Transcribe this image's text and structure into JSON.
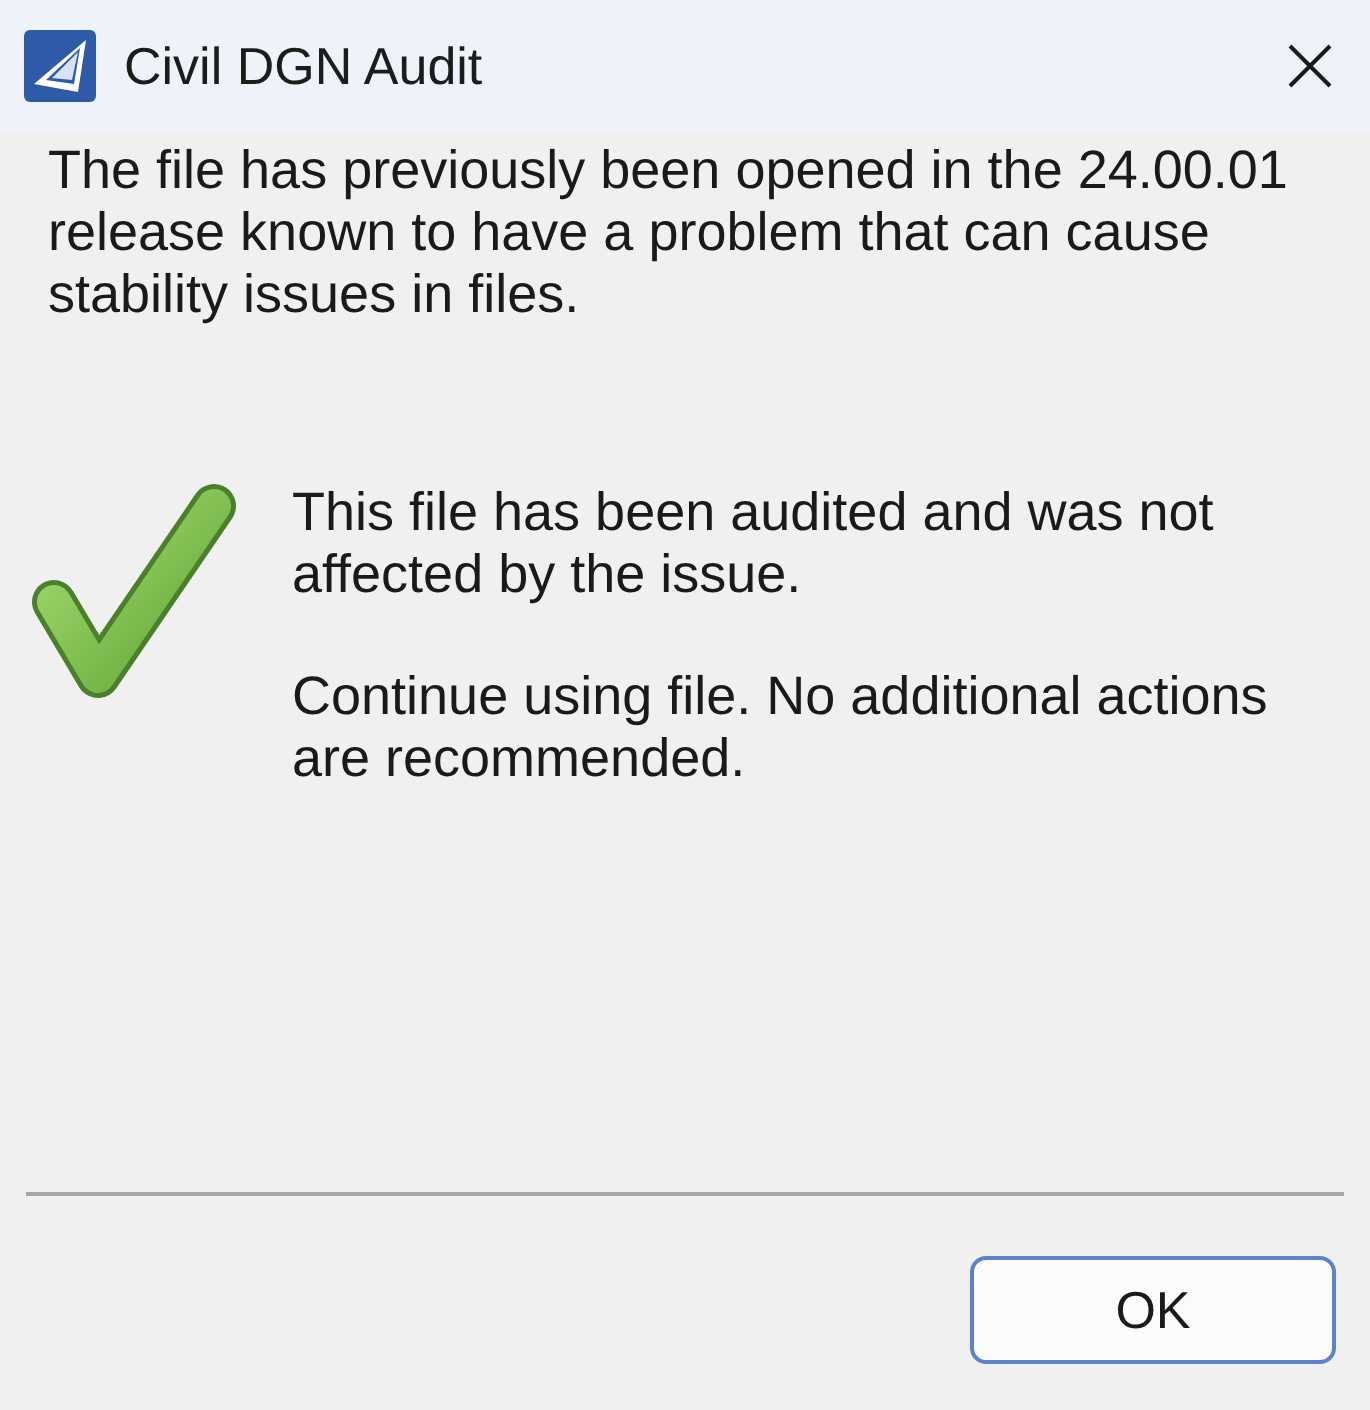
{
  "window": {
    "title": "Civil DGN Audit"
  },
  "message": "The file has previously been opened in the 24.00.01 release known to have a problem that can cause stability issues in files.",
  "result": {
    "kind": "success",
    "paragraphs": [
      "This file has been audited and was not affected by the issue.",
      "Continue using file. No additional actions are recommended."
    ]
  },
  "buttons": [
    {
      "label": "OK",
      "default": true
    }
  ]
}
